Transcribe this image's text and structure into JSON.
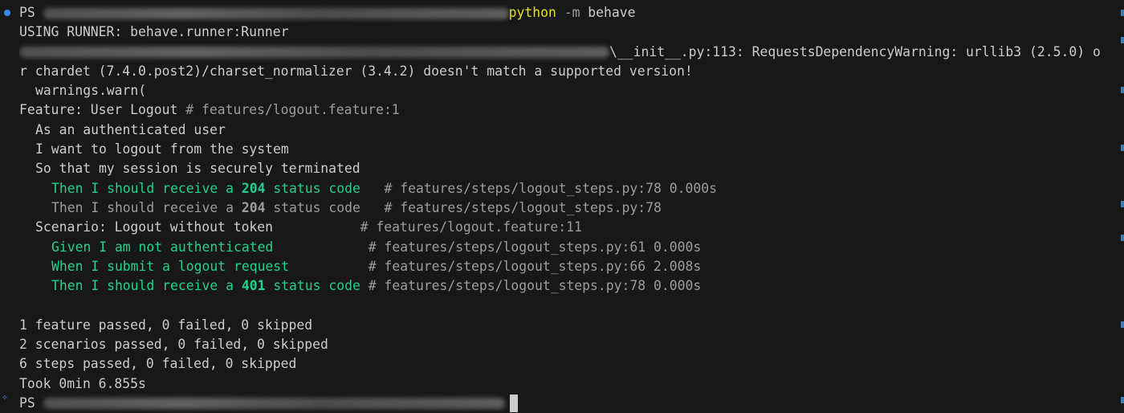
{
  "prompt": {
    "ps": "PS ",
    "command": "python",
    "flag": " -m",
    "args": " behave"
  },
  "runner_line": "USING RUNNER: behave.runner:Runner",
  "warning": {
    "path_tail": "\\__init__.py:113: RequestsDependencyWarning: urllib3 (2.5.0) o",
    "continued": "r chardet (7.4.0.post2)/charset_normalizer (3.4.2) doesn't match a supported version!",
    "call": "warnings.warn("
  },
  "feature": {
    "label": "Feature: User Logout",
    "comment": " # features/logout.feature:1",
    "description": [
      "As an authenticated user",
      "I want to logout from the system",
      "So that my session is securely terminated"
    ]
  },
  "step_prev_passed": {
    "prefix": "Then I should receive a ",
    "code": "204",
    "suffix": " status code",
    "comment": "   # features/steps/logout_steps.py:78 0.000s"
  },
  "step_prev_dim": {
    "prefix": "Then I should receive a ",
    "code": "204",
    "suffix": " status code",
    "comment": "   # features/steps/logout_steps.py:78"
  },
  "scenario": {
    "label": "Scenario: Logout without token",
    "comment": "           # features/logout.feature:11"
  },
  "steps": [
    {
      "text": "Given I am not authenticated",
      "comment": "            # features/steps/logout_steps.py:61 0.000s"
    },
    {
      "text": "When I submit a logout request",
      "comment": "          # features/steps/logout_steps.py:66 2.008s"
    }
  ],
  "step_last": {
    "prefix": "Then I should receive a ",
    "code": "401",
    "suffix": " status code",
    "comment": " # features/steps/logout_steps.py:78 0.000s"
  },
  "summary": [
    "1 feature passed, 0 failed, 0 skipped",
    "2 scenarios passed, 0 failed, 0 skipped",
    "6 steps passed, 0 failed, 0 skipped",
    "Took 0min 6.855s"
  ],
  "final_prompt": "PS ",
  "icons": {
    "gutter_dot": "decoration-dot-icon",
    "gutter_sparkle": "sparkle-icon"
  },
  "colors": {
    "background": "#181818",
    "foreground": "#cccccc",
    "green": "#23d18b",
    "yellow": "#e5e510",
    "dim": "#9d9d9d",
    "accent": "#3c8ce7"
  }
}
